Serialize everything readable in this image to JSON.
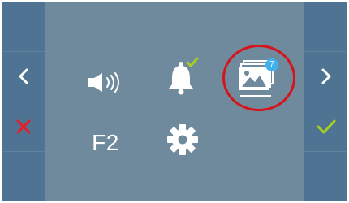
{
  "colors": {
    "panel_background": "#6f8a9c",
    "side_bar": "#4f7393",
    "icon": "#ffffff",
    "accept_green": "#a6cf1f",
    "cancel_red": "#e3202a",
    "badge_blue": "#3fb1ec",
    "highlight_red": "#d6141b"
  },
  "left_bar": {
    "prev_icon": "chevron-left-icon",
    "cancel_icon": "x-icon"
  },
  "right_bar": {
    "next_icon": "chevron-right-icon",
    "confirm_icon": "checkmark-icon"
  },
  "menu": {
    "volume_icon": "speaker-volume-icon",
    "bell_icon": "bell-icon",
    "bell_status_icon": "checkmark-icon",
    "gallery_icon": "image-gallery-icon",
    "gallery_badge": "7",
    "gallery_selected": true,
    "f2_label": "F2",
    "settings_icon": "gear-icon"
  }
}
